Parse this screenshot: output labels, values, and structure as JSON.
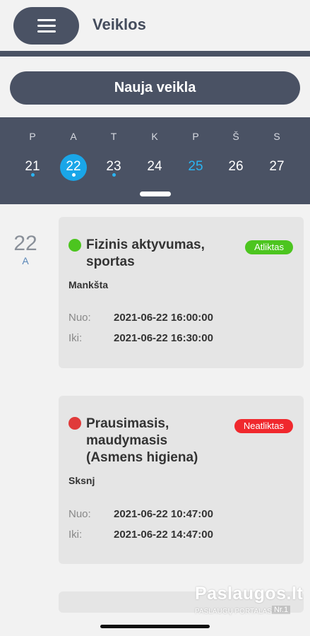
{
  "header": {
    "title": "Veiklos",
    "menu_icon": "hamburger-icon"
  },
  "new_activity_label": "Nauja veikla",
  "calendar": {
    "days": [
      {
        "letter": "P",
        "number": "21",
        "dot": true,
        "selected": false,
        "today": false
      },
      {
        "letter": "A",
        "number": "22",
        "dot": true,
        "selected": true,
        "today": false
      },
      {
        "letter": "T",
        "number": "23",
        "dot": true,
        "selected": false,
        "today": false
      },
      {
        "letter": "K",
        "number": "24",
        "dot": false,
        "selected": false,
        "today": false
      },
      {
        "letter": "P",
        "number": "25",
        "dot": false,
        "selected": false,
        "today": true
      },
      {
        "letter": "Š",
        "number": "26",
        "dot": false,
        "selected": false,
        "today": false
      },
      {
        "letter": "S",
        "number": "27",
        "dot": false,
        "selected": false,
        "today": false
      }
    ]
  },
  "date_group": {
    "day": "22",
    "weekday": "A"
  },
  "activities": [
    {
      "title": "Fizinis aktyvumas, sportas",
      "status": "Atliktas",
      "status_color": "#4cc51f",
      "subtitle": "Mankšta",
      "from_label": "Nuo:",
      "from_value": "2021-06-22 16:00:00",
      "to_label": "Iki:",
      "to_value": "2021-06-22 16:30:00"
    },
    {
      "title": "Prausimasis, maudymasis (Asmens higiena)",
      "status": "Neatliktas",
      "status_color": "#f0282d",
      "subtitle": "Sksnj",
      "from_label": "Nuo:",
      "from_value": "2021-06-22 10:47:00",
      "to_label": "Iki:",
      "to_value": "2021-06-22 14:47:00"
    }
  ],
  "watermark": {
    "brand": "Paslaugos.lt",
    "tagline": "PASLAUGŲ PORTALAS",
    "rank": "Nr.1"
  },
  "colors": {
    "primary": "#4a5264",
    "accent": "#1aa6e8",
    "background": "#f2f2f2",
    "card": "#e5e5e5"
  }
}
